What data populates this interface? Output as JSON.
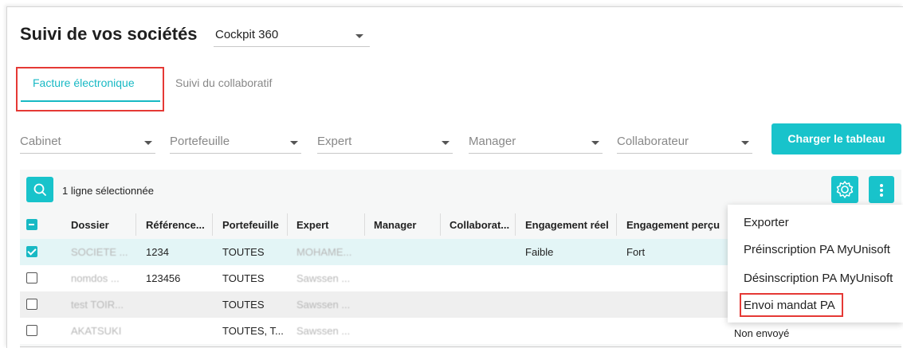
{
  "page": {
    "title": "Suivi de vos sociétés",
    "view_select": "Cockpit 360"
  },
  "tabs": [
    {
      "label": "Facture électronique",
      "active": true
    },
    {
      "label": "Suivi du collaboratif",
      "active": false
    }
  ],
  "filters": {
    "cabinet": "Cabinet",
    "portefeuille": "Portefeuille",
    "expert": "Expert",
    "manager": "Manager",
    "collaborateur": "Collaborateur"
  },
  "load_button": "Charger le tableau",
  "toolbar": {
    "selection_text": "1 ligne sélectionnée"
  },
  "columns": [
    "Dossier",
    "Référence...",
    "Portefeuille",
    "Expert",
    "Manager",
    "Collaborat...",
    "Engagement réel",
    "Engagement perçu"
  ],
  "rows": [
    {
      "checked": true,
      "dossier": "SOCIETE ...",
      "reference": "1234",
      "portefeuille": "TOUTES",
      "expert": "MOHAME...",
      "manager": "",
      "collaborateur": "",
      "engagement_reel": "Faible",
      "engagement_percu": "Fort",
      "status": ""
    },
    {
      "checked": false,
      "dossier": "nomdos ...",
      "reference": "123456",
      "portefeuille": "TOUTES",
      "expert": "Sawssen ...",
      "manager": "",
      "collaborateur": "",
      "engagement_reel": "",
      "engagement_percu": "",
      "status": ""
    },
    {
      "checked": false,
      "dossier": "test TOIR...",
      "reference": "",
      "portefeuille": "TOUTES",
      "expert": "Sawssen ...",
      "manager": "",
      "collaborateur": "",
      "engagement_reel": "",
      "engagement_percu": "",
      "status": ""
    },
    {
      "checked": false,
      "dossier": "AKATSUKI",
      "reference": "",
      "portefeuille": "TOUTES, T...",
      "expert": "Sawssen ...",
      "manager": "",
      "collaborateur": "",
      "engagement_reel": "",
      "engagement_percu": "",
      "status": "Non envoyé"
    }
  ],
  "menu": {
    "items": [
      "Exporter",
      "Préinscription PA MyUnisoft",
      "Désinscription PA MyUnisoft",
      "Envoi mandat PA"
    ]
  },
  "colors": {
    "accent": "#18c3cb",
    "highlight": "#e53935"
  },
  "icons": {
    "search": "search-icon",
    "settings": "gear-icon",
    "more": "more-vertical-icon"
  }
}
